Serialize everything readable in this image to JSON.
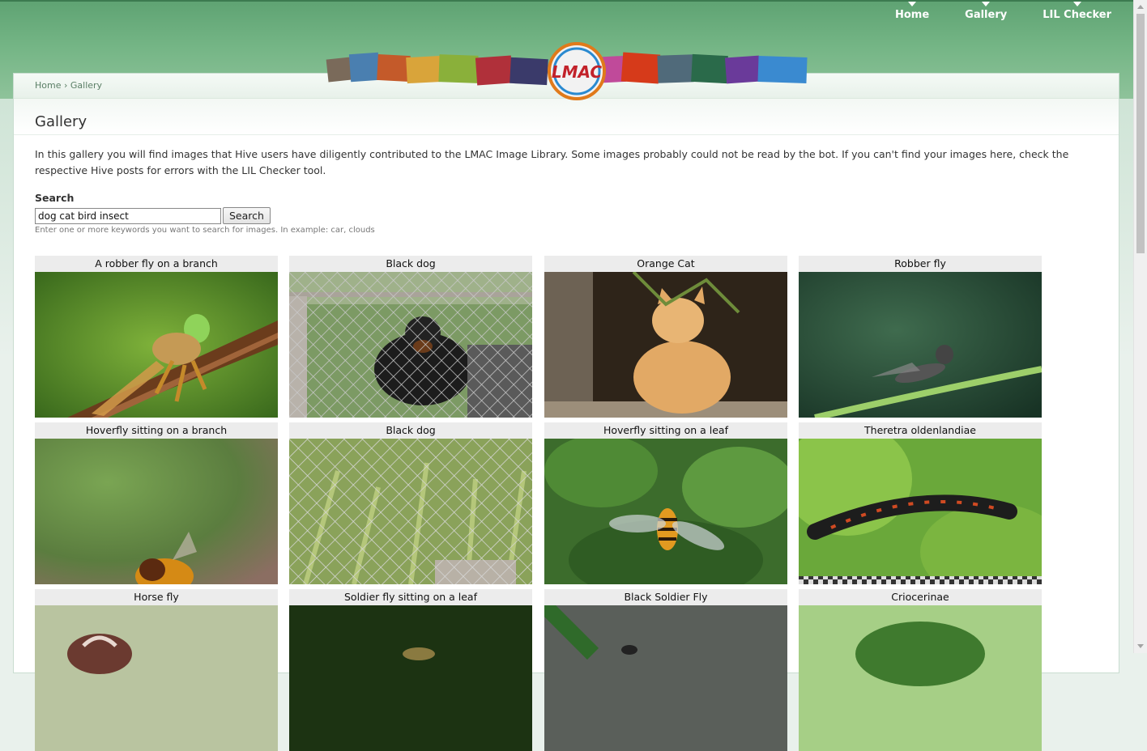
{
  "nav": {
    "items": [
      "Home",
      "Gallery",
      "LIL Checker"
    ]
  },
  "logo": {
    "text": "LMAC"
  },
  "breadcrumb": {
    "home": "Home",
    "separator": "›",
    "current": "Gallery"
  },
  "page": {
    "title": "Gallery",
    "intro": "In this gallery you will find images that Hive users have diligently contributed to the LMAC Image Library. Some images probably could not be read by the bot. If you can't find your images here, check the respective Hive posts for errors with the LIL Checker tool."
  },
  "search": {
    "label": "Search",
    "value": "dog cat bird insect",
    "button": "Search",
    "hint": "Enter one or more keywords you want to search for images. In example: car, clouds"
  },
  "gallery": {
    "items": [
      {
        "caption": "A robber fly on a branch"
      },
      {
        "caption": "Black dog"
      },
      {
        "caption": "Orange Cat"
      },
      {
        "caption": "Robber fly"
      },
      {
        "caption": "Hoverfly sitting on a branch"
      },
      {
        "caption": "Black dog"
      },
      {
        "caption": "Hoverfly sitting on a leaf"
      },
      {
        "caption": "Theretra oldenlandiae"
      },
      {
        "caption": "Horse fly"
      },
      {
        "caption": "Soldier fly sitting on a leaf"
      },
      {
        "caption": "Black Soldier Fly"
      },
      {
        "caption": "Criocerinae"
      }
    ]
  },
  "colors": {
    "header_green": "#74b585",
    "accent": "#5b7f66"
  }
}
